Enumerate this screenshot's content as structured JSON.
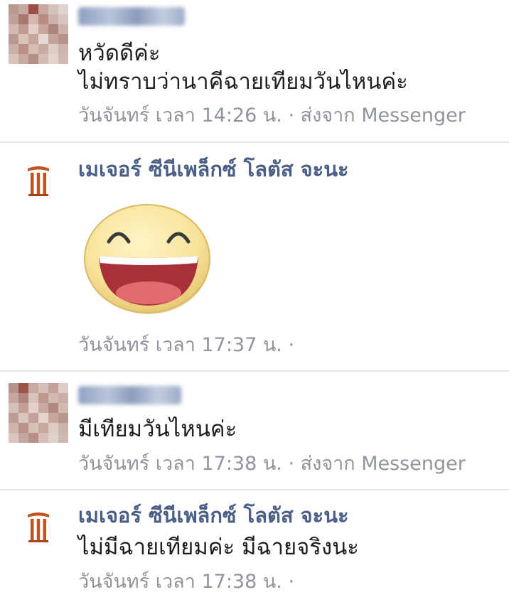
{
  "colors": {
    "page_name": "#4b5f86",
    "body_text": "#1c1e21",
    "meta_text": "#90949c",
    "divider": "#e4e6eb",
    "logo": "#c2521f"
  },
  "messages": [
    {
      "sender_type": "user",
      "avatar": "pixelated-user-avatar",
      "name_blurred": true,
      "lines": [
        "หวัดดีค่ะ",
        "ไม่ทราบว่านาคีฉายเทียมวันไหนค่ะ"
      ],
      "meta": "วันจันทร์ เวลา 14:26 น. · ส่งจาก Messenger"
    },
    {
      "sender_type": "page",
      "sender_name": "เมเจอร์ ซีนีเพล็กซ์ โลตัส จะนะ",
      "sticker": "laughing-smiley-sticker",
      "meta": "วันจันทร์ เวลา 17:37 น. ·"
    },
    {
      "sender_type": "user",
      "avatar": "pixelated-user-avatar",
      "name_blurred": true,
      "lines": [
        "มีเทียมวันไหนค่ะ"
      ],
      "meta": "วันจันทร์ เวลา 17:38 น. · ส่งจาก Messenger"
    },
    {
      "sender_type": "page",
      "sender_name": "เมเจอร์ ซีนีเพล็กซ์ โลตัส จะนะ",
      "lines": [
        "ไม่มีฉายเทียมค่ะ มีฉายจริงนะ"
      ],
      "meta": "วันจันทร์ เวลา 17:38 น. ·"
    }
  ]
}
